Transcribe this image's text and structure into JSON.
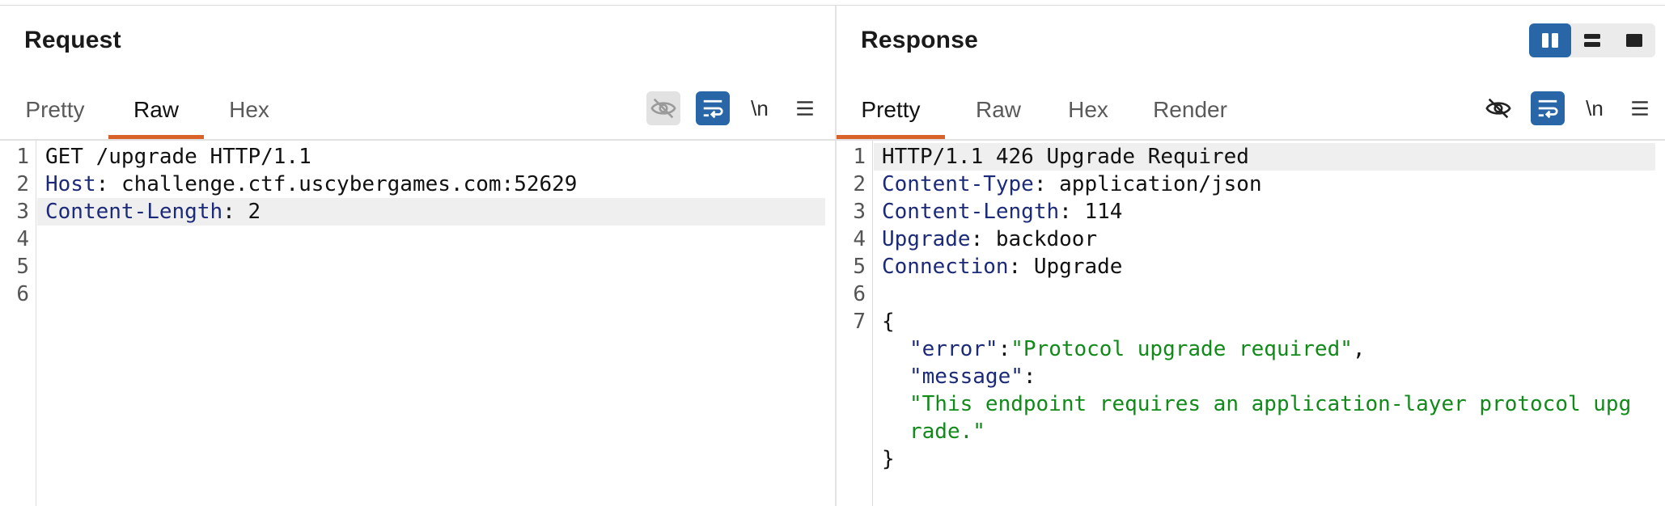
{
  "request": {
    "title": "Request",
    "tabs": [
      "Pretty",
      "Raw",
      "Hex"
    ],
    "active_tab": "Raw",
    "newline_label": "\\n",
    "lines": [
      {
        "num": "1",
        "key": "",
        "sep": "",
        "val": "GET /upgrade HTTP/1.1"
      },
      {
        "num": "2",
        "key": "Host",
        "sep": ": ",
        "val": "challenge.ctf.uscybergames.com:52629"
      },
      {
        "num": "3",
        "key": "Content-Length",
        "sep": ": ",
        "val": "2"
      },
      {
        "num": "4",
        "key": "",
        "sep": "",
        "val": ""
      },
      {
        "num": "5",
        "key": "",
        "sep": "",
        "val": ""
      },
      {
        "num": "6",
        "key": "",
        "sep": "",
        "val": ""
      }
    ]
  },
  "response": {
    "title": "Response",
    "tabs": [
      "Pretty",
      "Raw",
      "Hex",
      "Render"
    ],
    "active_tab": "Pretty",
    "newline_label": "\\n",
    "lines": [
      {
        "num": "1",
        "key": "",
        "sep": "",
        "val": "HTTP/1.1 426 Upgrade Required"
      },
      {
        "num": "2",
        "key": "Content-Type",
        "sep": ": ",
        "val": "application/json"
      },
      {
        "num": "3",
        "key": "Content-Length",
        "sep": ": ",
        "val": "114"
      },
      {
        "num": "4",
        "key": "Upgrade",
        "sep": ": ",
        "val": "backdoor"
      },
      {
        "num": "5",
        "key": "Connection",
        "sep": ": ",
        "val": "Upgrade"
      },
      {
        "num": "6",
        "key": "",
        "sep": "",
        "val": ""
      },
      {
        "num": "7",
        "key": "",
        "sep": "",
        "val": "{"
      }
    ],
    "json_body": {
      "error_key": "\"error\"",
      "error_colon": ":",
      "error_val": "\"Protocol upgrade required\"",
      "error_comma": ",",
      "message_key": "\"message\"",
      "message_colon": ":",
      "message_val_1": "\"This endpoint requires an application-layer protocol upg",
      "message_val_2": "rade.\"",
      "close": "}"
    }
  },
  "colors": {
    "accent_tab": "#d9622b",
    "active_blue": "#2866a8",
    "header_key": "#1c2a7a",
    "json_string": "#118a1a"
  },
  "icons": {
    "hide": "eye-slash-icon",
    "wrap": "wrap-lines-icon",
    "menu": "hamburger-menu-icon",
    "layout": [
      "split-vertical-icon",
      "split-horizontal-icon",
      "single-pane-icon"
    ]
  }
}
